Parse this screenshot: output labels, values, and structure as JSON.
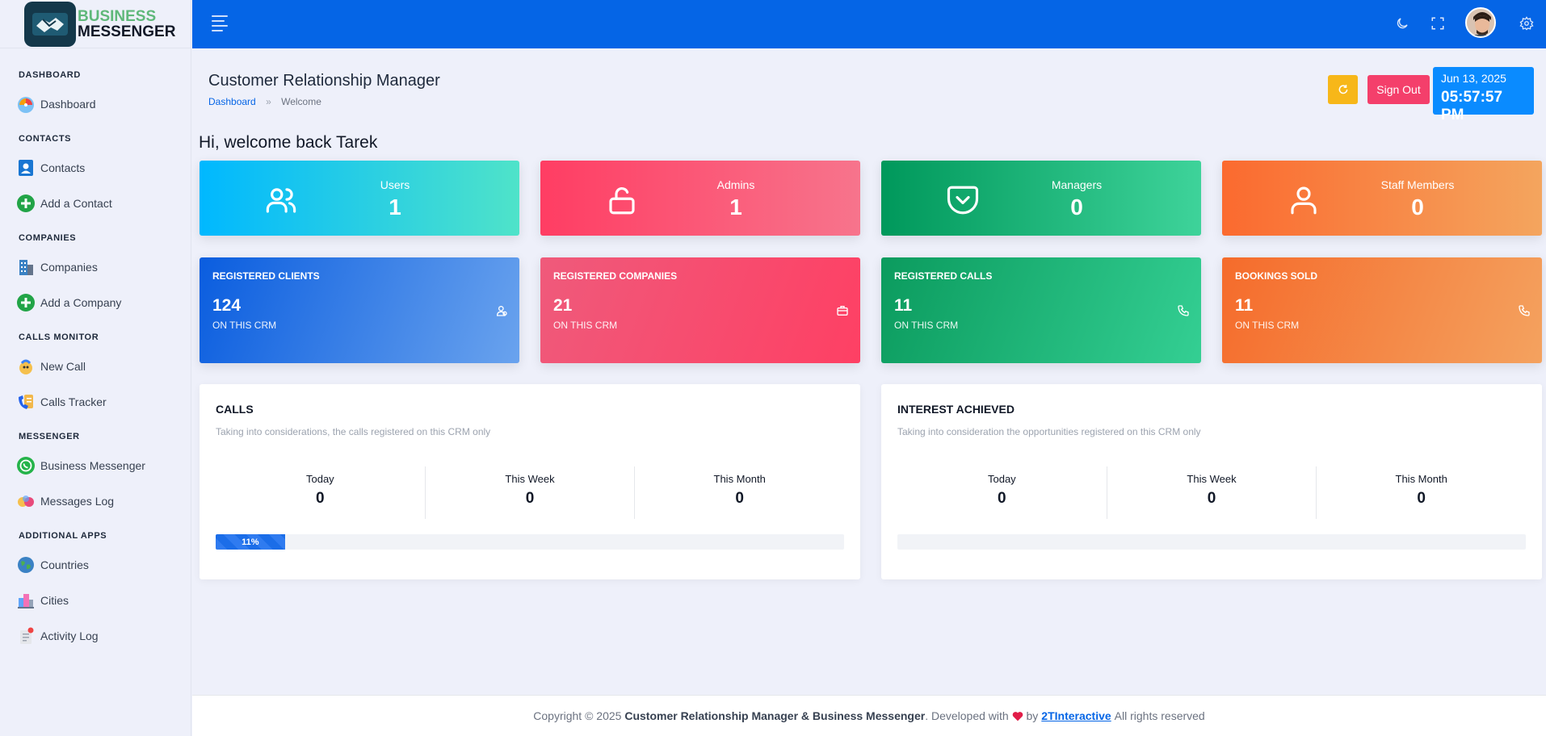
{
  "logo": {
    "line1": "BUSINESS",
    "line2": "MESSENGER"
  },
  "sidebar": {
    "sections": [
      {
        "title": "DASHBOARD",
        "items": [
          {
            "label": "Dashboard",
            "icon": "gauge-icon"
          }
        ]
      },
      {
        "title": "CONTACTS",
        "items": [
          {
            "label": "Contacts",
            "icon": "contacts-icon"
          },
          {
            "label": "Add a Contact",
            "icon": "plus-circle-icon"
          }
        ]
      },
      {
        "title": "COMPANIES",
        "items": [
          {
            "label": "Companies",
            "icon": "building-icon"
          },
          {
            "label": "Add a Company",
            "icon": "plus-circle-icon"
          }
        ]
      },
      {
        "title": "CALLS MONITOR",
        "items": [
          {
            "label": "New Call",
            "icon": "new-call-icon"
          },
          {
            "label": "Calls Tracker",
            "icon": "calls-tracker-icon"
          }
        ]
      },
      {
        "title": "MESSENGER",
        "items": [
          {
            "label": "Business Messenger",
            "icon": "whatsapp-icon"
          },
          {
            "label": "Messages Log",
            "icon": "messages-icon"
          }
        ]
      },
      {
        "title": "ADDITIONAL APPS",
        "items": [
          {
            "label": "Countries",
            "icon": "globe-icon"
          },
          {
            "label": "Cities",
            "icon": "city-icon"
          },
          {
            "label": "Activity Log",
            "icon": "activity-icon"
          }
        ]
      }
    ]
  },
  "header": {
    "title": "Customer Relationship Manager",
    "breadcrumb": {
      "home": "Dashboard",
      "separator": "»",
      "current": "Welcome"
    },
    "sign_out": "Sign Out",
    "date": "Jun 13, 2025",
    "time": "05:57:57 PM"
  },
  "welcome": "Hi, welcome back Tarek",
  "stats": [
    {
      "label": "Users",
      "value": "1",
      "icon": "users-icon",
      "gradient": [
        "#00b8ff",
        "#4fe3c9"
      ]
    },
    {
      "label": "Admins",
      "value": "1",
      "icon": "unlock-icon",
      "gradient": [
        "#ff3d63",
        "#f7748c"
      ]
    },
    {
      "label": "Managers",
      "value": "0",
      "icon": "pocket-icon",
      "gradient": [
        "#00985b",
        "#3ed39a"
      ]
    },
    {
      "label": "Staff Members",
      "value": "0",
      "icon": "user-icon",
      "gradient": [
        "#fb6a2f",
        "#f4a55e"
      ]
    }
  ],
  "registered": [
    {
      "title": "REGISTERED CLIENTS",
      "value": "124",
      "sub": "ON THIS CRM",
      "icon": "clients-icon",
      "gradient": [
        "#0a5ddf",
        "#6aa3ee"
      ]
    },
    {
      "title": "REGISTERED COMPANIES",
      "value": "21",
      "sub": "ON THIS CRM",
      "icon": "briefcase-icon",
      "gradient": [
        "#ef5a7b",
        "#fe4064"
      ]
    },
    {
      "title": "REGISTERED CALLS",
      "value": "11",
      "sub": "ON THIS CRM",
      "icon": "phone-icon",
      "gradient": [
        "#0b9b5e",
        "#34cf93"
      ]
    },
    {
      "title": "BOOKINGS SOLD",
      "value": "11",
      "sub": "ON THIS CRM",
      "icon": "phone-icon",
      "gradient": [
        "#f56b2b",
        "#f4a25f"
      ]
    }
  ],
  "panels": [
    {
      "title": "CALLS",
      "desc": "Taking into considerations, the calls registered on this CRM only",
      "columns": [
        {
          "label": "Today",
          "value": "0"
        },
        {
          "label": "This Week",
          "value": "0"
        },
        {
          "label": "This Month",
          "value": "0"
        }
      ],
      "progress": 11,
      "progress_label": "11%"
    },
    {
      "title": "INTEREST ACHIEVED",
      "desc": "Taking into consideration the opportunities registered on this CRM only",
      "columns": [
        {
          "label": "Today",
          "value": "0"
        },
        {
          "label": "This Week",
          "value": "0"
        },
        {
          "label": "This Month",
          "value": "0"
        }
      ],
      "progress": 0,
      "progress_label": ""
    }
  ],
  "footer": {
    "prefix": "Copyright © 2025",
    "app": "Customer Relationship Manager & Business Messenger",
    "developed": ". Developed with",
    "by": "by",
    "link": "2TInteractive",
    "suffix": "All rights reserved"
  },
  "colors": {
    "primary": "#0565e6",
    "warning": "#f7b719",
    "danger": "#f43f6b",
    "clock": "#0a8bff"
  }
}
